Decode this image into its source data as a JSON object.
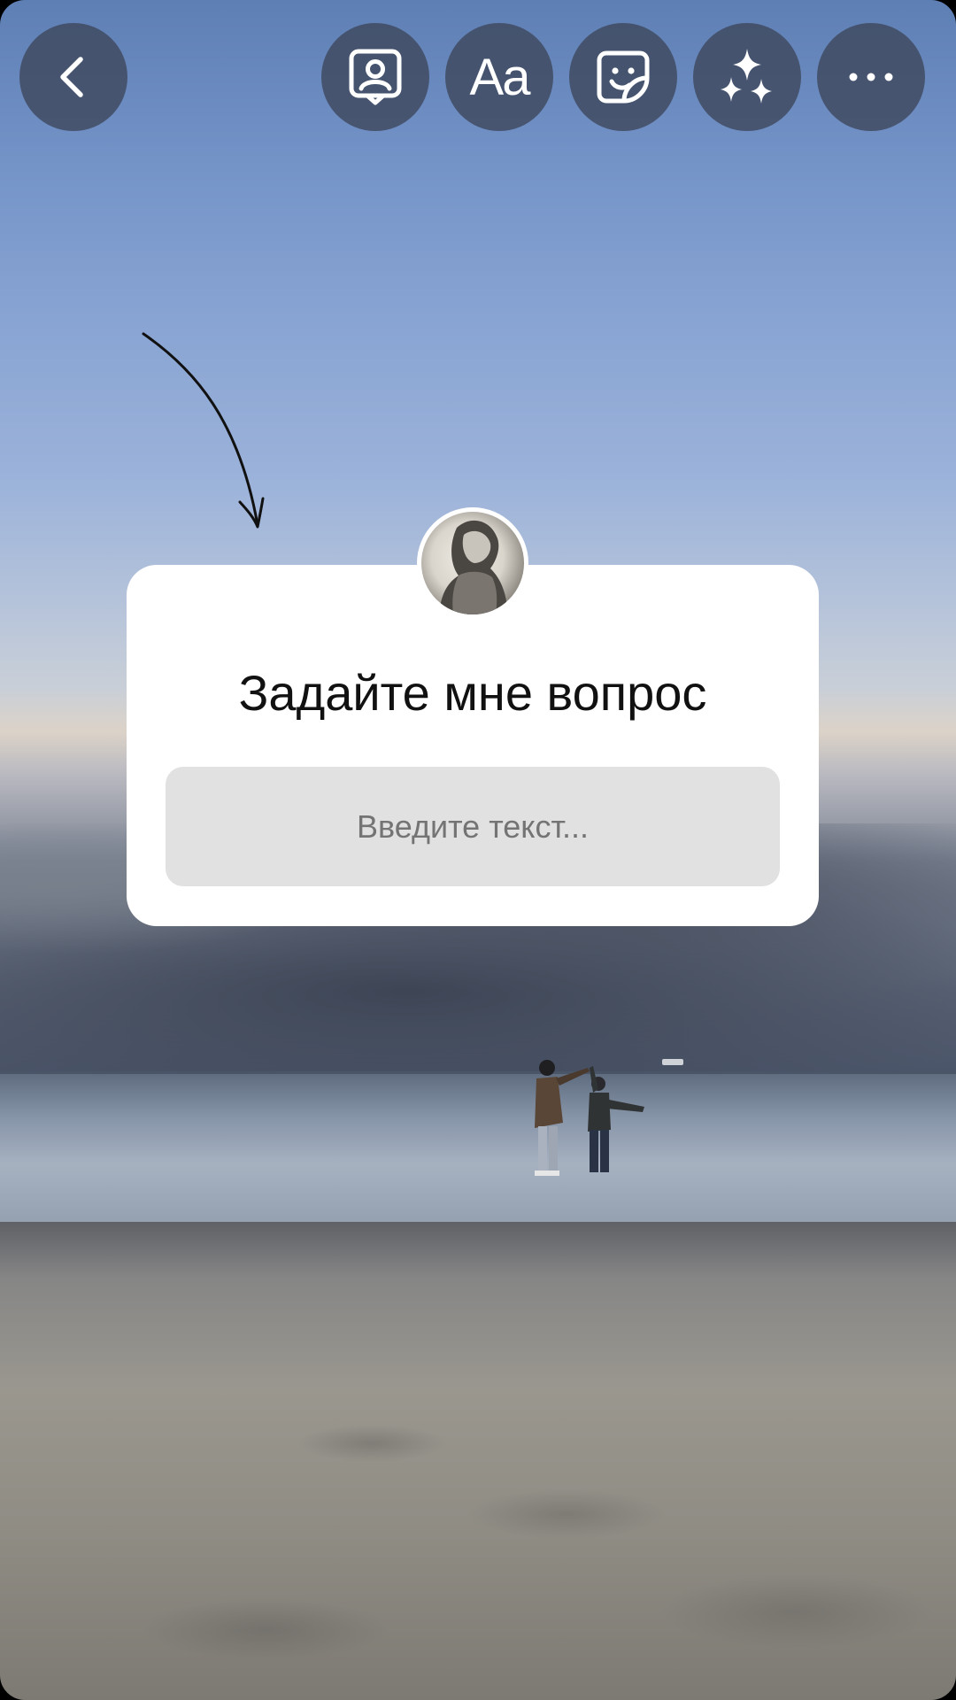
{
  "toolbar": {
    "back_icon": "chevron-left-icon",
    "mention_icon": "mention-person-icon",
    "text_label": "Aa",
    "sticker_icon": "sticker-icon",
    "effects_icon": "sparkles-icon",
    "more_icon": "more-horizontal-icon"
  },
  "sticker": {
    "title": "Задайте мне вопрос",
    "placeholder": "Введите текст..."
  },
  "colors": {
    "button_bg": "#3e485e",
    "sticker_bg": "#ffffff",
    "input_bg": "#e1e1e1"
  }
}
